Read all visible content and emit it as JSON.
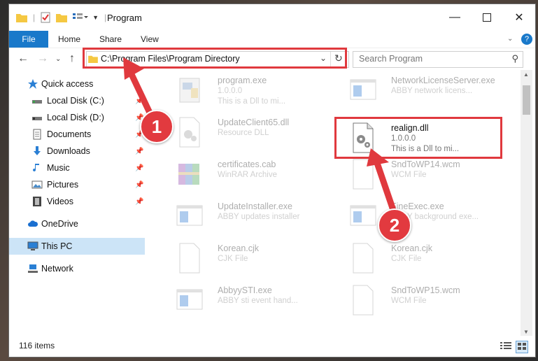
{
  "window": {
    "title": "Program"
  },
  "ribbon": {
    "tabs": [
      "File",
      "Home",
      "Share",
      "View"
    ]
  },
  "address": {
    "path": "C:\\Program Files\\Program Directory"
  },
  "search": {
    "placeholder": "Search Program"
  },
  "sidebar": {
    "items": [
      {
        "label": "Quick access",
        "icon": "star-icon"
      },
      {
        "label": "Local Disk (C:)",
        "icon": "drive-icon",
        "pinned": true
      },
      {
        "label": "Local Disk (D:)",
        "icon": "drive-icon",
        "pinned": true
      },
      {
        "label": "Documents",
        "icon": "documents-icon",
        "pinned": true
      },
      {
        "label": "Downloads",
        "icon": "download-icon",
        "pinned": true
      },
      {
        "label": "Music",
        "icon": "music-icon",
        "pinned": true
      },
      {
        "label": "Pictures",
        "icon": "pictures-icon",
        "pinned": true
      },
      {
        "label": "Videos",
        "icon": "videos-icon",
        "pinned": true
      },
      {
        "label": "OneDrive",
        "icon": "cloud-icon"
      },
      {
        "label": "This PC",
        "icon": "pc-icon",
        "selected": true
      },
      {
        "label": "Network",
        "icon": "network-icon"
      }
    ]
  },
  "files": [
    {
      "name": "program.exe",
      "line2": "1.0.0.0",
      "line3": "This is a Dll to mi...",
      "icon": "exe-icon"
    },
    {
      "name": "NetworkLicenseServer.exe",
      "line2": "ABBY network licens...",
      "line3": "",
      "icon": "app-window-icon"
    },
    {
      "name": "UpdateClient65.dll",
      "line2": "Resource DLL",
      "line3": "",
      "icon": "dll-gear-icon"
    },
    {
      "name": "realign.dll",
      "line2": "1.0.0.0",
      "line3": "This is a Dll to mi...",
      "icon": "dll-gear-icon"
    },
    {
      "name": "certificates.cab",
      "line2": "WinRAR Archive",
      "line3": "",
      "icon": "archive-icon"
    },
    {
      "name": "SndToWP14.wcm",
      "line2": "WCM File",
      "line3": "",
      "icon": "blank-file-icon"
    },
    {
      "name": "UpdateInstaller.exe",
      "line2": "ABBY updates installer",
      "line3": "",
      "icon": "app-window-icon"
    },
    {
      "name": "FineExec.exe",
      "line2": "ABBY background exe...",
      "line3": "",
      "icon": "app-window-icon"
    },
    {
      "name": "Korean.cjk",
      "line2": "CJK File",
      "line3": "",
      "icon": "blank-file-icon"
    },
    {
      "name": "Korean.cjk",
      "line2": "CJK File",
      "line3": "",
      "icon": "blank-file-icon"
    },
    {
      "name": "AbbyySTI.exe",
      "line2": "ABBY sti event hand...",
      "line3": "",
      "icon": "app-window-icon"
    },
    {
      "name": "SndToWP15.wcm",
      "line2": "WCM File",
      "line3": "",
      "icon": "blank-file-icon"
    }
  ],
  "status": {
    "count": "116 items"
  },
  "annotations": {
    "step1": "1",
    "step2": "2",
    "color": "#e0393e"
  }
}
